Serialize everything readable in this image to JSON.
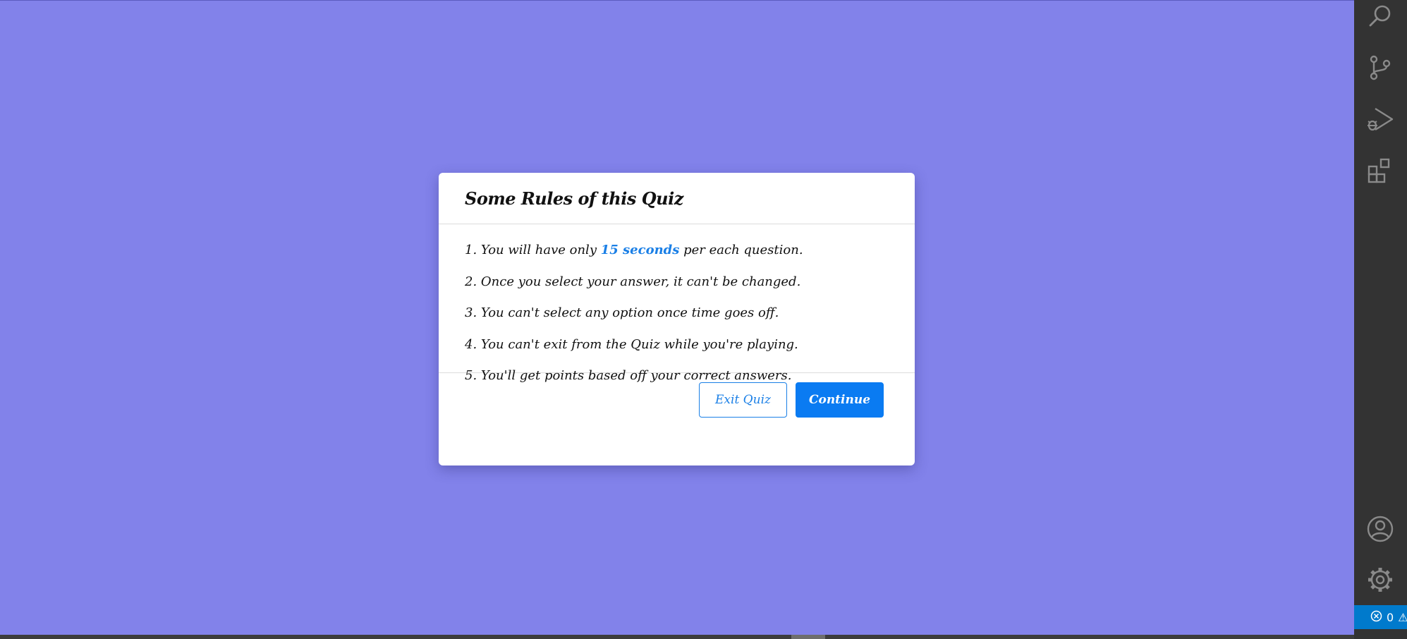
{
  "page": {
    "background_color": "#8282ea"
  },
  "dialog": {
    "title": "Some Rules of this Quiz",
    "rules": [
      {
        "before": "1. You will have only ",
        "highlight": "15 seconds",
        "after": " per each question."
      },
      {
        "text": "2. Once you select your answer, it can't be changed."
      },
      {
        "text": "3. You can't select any option once time goes off."
      },
      {
        "text": "4. You can't exit from the Quiz while you're playing."
      },
      {
        "text": "5. You'll get points based off your correct answers."
      }
    ],
    "exit_label": "Exit Quiz",
    "continue_label": "Continue",
    "accent_color": "#0a7bf2"
  },
  "activity_bar": {
    "icons": [
      "search-icon",
      "source-control-icon",
      "run-debug-icon",
      "extensions-icon",
      "account-icon",
      "settings-gear-icon"
    ]
  },
  "status_bar": {
    "errors_count": "0",
    "warning_glyph": "⚠"
  }
}
